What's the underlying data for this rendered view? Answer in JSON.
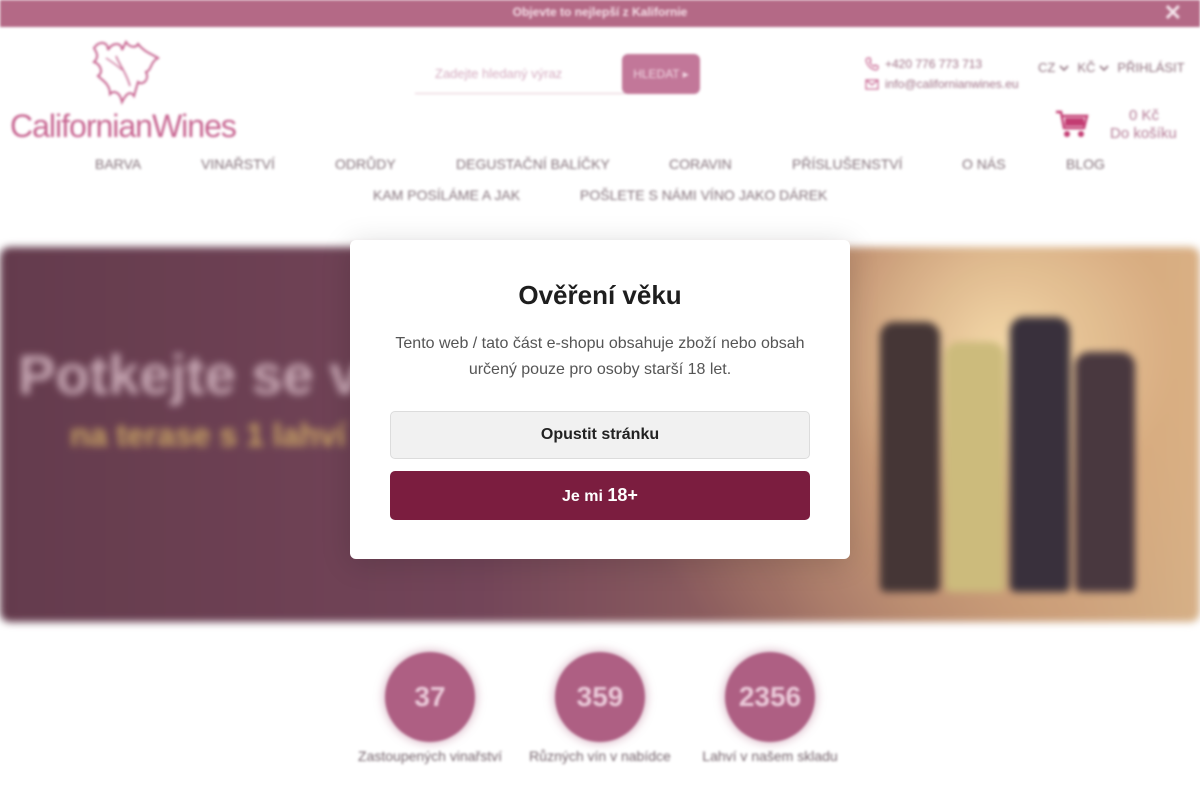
{
  "topbar": {
    "text": "Objevte to nejlepší z Kalifornie",
    "close_symbol": "✕"
  },
  "logo": {
    "text": "CalifornianWines"
  },
  "search": {
    "placeholder": "Zadejte hledaný výraz",
    "button": "HLEDAT"
  },
  "contact": {
    "phone": "+420 776 773 713",
    "email": "info@californianwines.eu"
  },
  "header": {
    "language": "CZ",
    "currency": "KČ",
    "login": "PŘIHLÁSIT"
  },
  "cart": {
    "price": "0 Kč",
    "label": "Do košíku"
  },
  "nav": {
    "row1": [
      "BARVA",
      "VINAŘSTVÍ",
      "ODRŮDY",
      "DEGUSTAČNÍ BALÍČKY",
      "CORAVIN",
      "PŘÍSLUŠENSTVÍ",
      "O NÁS",
      "BLOG"
    ],
    "row2": [
      "KAM POSÍLÁME A JAK",
      "POŠLETE S NÁMI VÍNO JAKO DÁREK"
    ]
  },
  "hero": {
    "title": "Potkejte se v",
    "subtitle": "na terase s 1 lahví"
  },
  "stats": [
    {
      "value": "37",
      "label": "Zastoupených vinařství"
    },
    {
      "value": "359",
      "label": "Různých vín v nabídce"
    },
    {
      "value": "2356",
      "label": "Lahví v našem skladu"
    }
  ],
  "modal": {
    "title": "Ověření věku",
    "text": "Tento web / tato část e-shopu obsahuje zboží nebo obsah určený pouze pro osoby starší 18 let.",
    "leave_button": "Opustit stránku",
    "confirm_prefix": "Je mi",
    "confirm_age": "18+"
  },
  "colors": {
    "brand": "#c45b8a",
    "topbar": "#b0607f",
    "confirm": "#7b1d3f"
  }
}
